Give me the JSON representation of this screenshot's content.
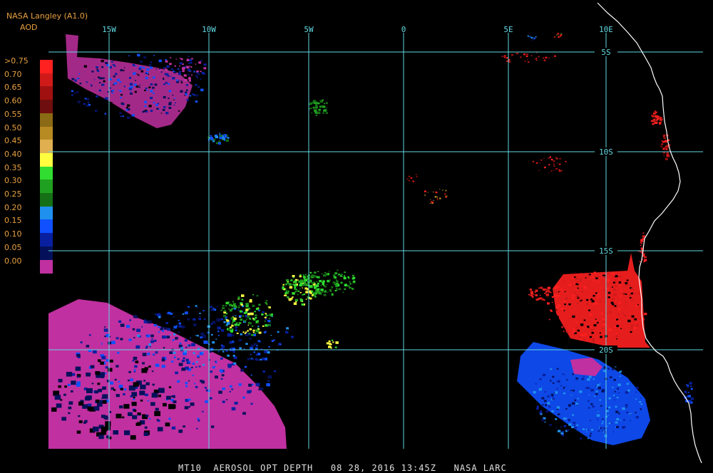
{
  "source_label": "NASA Langley (A1.0)",
  "variable_label": "AOD",
  "legend": {
    "labels": [
      ">0.75",
      "0.70",
      "0.65",
      "0.60",
      "0.55",
      "0.50",
      "0.45",
      "0.40",
      "0.35",
      "0.30",
      "0.25",
      "0.20",
      "0.15",
      "0.10",
      "0.05",
      "0.00"
    ],
    "colors": [
      "#ff2020",
      "#d01a1a",
      "#a01010",
      "#6e0e0e",
      "#8a6a14",
      "#b88a22",
      "#e0b050",
      "#ffff40",
      "#30dd30",
      "#20a020",
      "#157015",
      "#2090ee",
      "#1050ff",
      "#0820a0",
      "#05105a",
      "#c030a0"
    ]
  },
  "grid": {
    "lon_labels": [
      "15W",
      "10W",
      "5W",
      "0",
      "5E",
      "10E"
    ],
    "lat_labels": [
      "5S",
      "10S",
      "15S",
      "20S"
    ],
    "line_color": "#60d8e0"
  },
  "footer": {
    "product": "MT10",
    "title": "AEROSOL OPT DEPTH",
    "date": "08 28, 2016",
    "time": "13:45Z",
    "agency": "NASA LARC"
  }
}
